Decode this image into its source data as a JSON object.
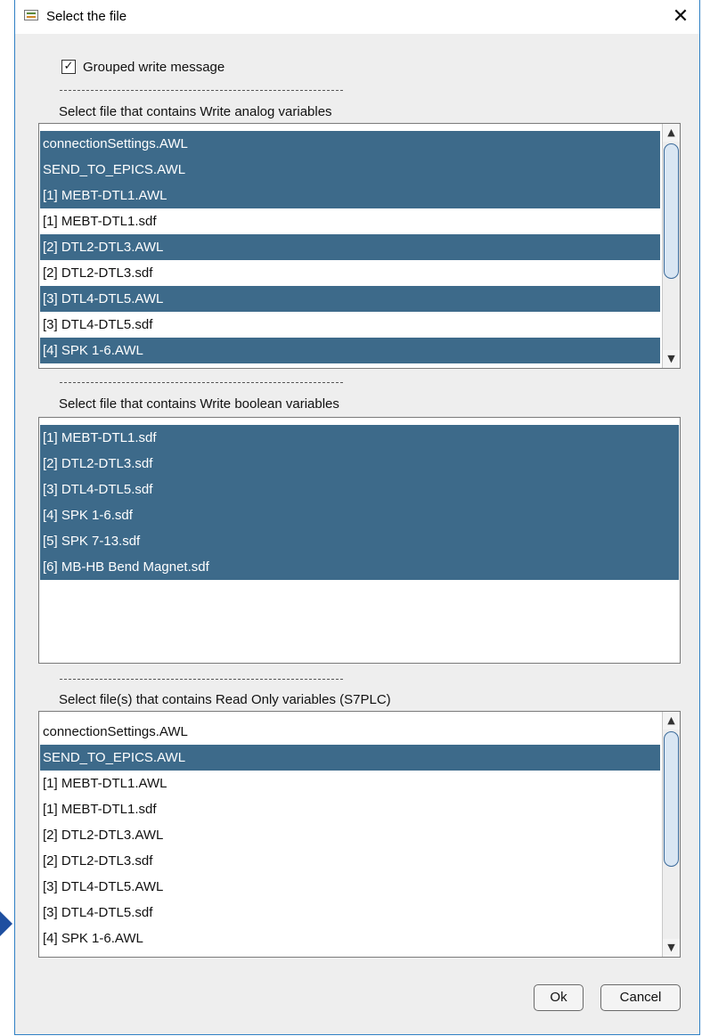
{
  "window": {
    "title": "Select the file",
    "close_glyph": "✕"
  },
  "options": {
    "grouped_label": "Grouped write message",
    "grouped_checked": true,
    "check_glyph": "✓"
  },
  "divider_text": "-------------------------------------------------------------",
  "analog": {
    "label": "Select file that contains Write analog variables",
    "items": [
      {
        "label": "connectionSettings.AWL",
        "selected": true
      },
      {
        "label": "SEND_TO_EPICS.AWL",
        "selected": true
      },
      {
        "label": "[1] MEBT-DTL1.AWL",
        "selected": true
      },
      {
        "label": "[1] MEBT-DTL1.sdf",
        "selected": false
      },
      {
        "label": "[2] DTL2-DTL3.AWL",
        "selected": true
      },
      {
        "label": "[2] DTL2-DTL3.sdf",
        "selected": false
      },
      {
        "label": "[3] DTL4-DTL5.AWL",
        "selected": true
      },
      {
        "label": "[3] DTL4-DTL5.sdf",
        "selected": false
      },
      {
        "label": "[4] SPK 1-6.AWL",
        "selected": true
      }
    ]
  },
  "boolean": {
    "label": "Select file that contains Write boolean variables",
    "items": [
      {
        "label": "[1] MEBT-DTL1.sdf",
        "selected": true
      },
      {
        "label": "[2] DTL2-DTL3.sdf",
        "selected": true
      },
      {
        "label": "[3] DTL4-DTL5.sdf",
        "selected": true
      },
      {
        "label": "[4] SPK 1-6.sdf",
        "selected": true
      },
      {
        "label": "[5] SPK 7-13.sdf",
        "selected": true
      },
      {
        "label": "[6] MB-HB Bend Magnet.sdf",
        "selected": true
      }
    ]
  },
  "readonly": {
    "label": "Select file(s) that contains Read Only variables (S7PLC)",
    "items": [
      {
        "label": "connectionSettings.AWL",
        "selected": false
      },
      {
        "label": "SEND_TO_EPICS.AWL",
        "selected": true
      },
      {
        "label": "[1] MEBT-DTL1.AWL",
        "selected": false
      },
      {
        "label": "[1] MEBT-DTL1.sdf",
        "selected": false
      },
      {
        "label": "[2] DTL2-DTL3.AWL",
        "selected": false
      },
      {
        "label": "[2] DTL2-DTL3.sdf",
        "selected": false
      },
      {
        "label": "[3] DTL4-DTL5.AWL",
        "selected": false
      },
      {
        "label": "[3] DTL4-DTL5.sdf",
        "selected": false
      },
      {
        "label": "[4] SPK 1-6.AWL",
        "selected": false
      }
    ]
  },
  "scroll_glyphs": {
    "up": "▲",
    "down": "▼"
  },
  "buttons": {
    "ok": "Ok",
    "cancel": "Cancel"
  },
  "colors": {
    "selection": "#3d6a8a",
    "window_border": "#2f80c4",
    "pointer_arrow": "#1e4fa0"
  }
}
